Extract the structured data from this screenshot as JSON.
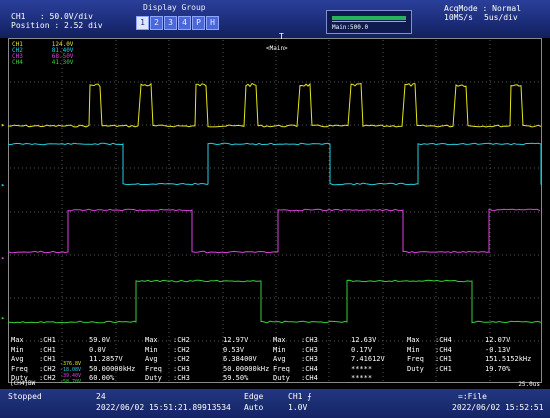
{
  "topbar": {
    "ch1_scale": "CH1   : 50.0V/div",
    "position": "Position : 2.52 div",
    "display_group_title": "Display Group",
    "tabs": [
      "1",
      "2",
      "3",
      "4",
      "P",
      "H"
    ],
    "active_tab": "1",
    "main_zoom": "Main:500.0",
    "acq_mode": "AcqMode : Normal",
    "rate": "10MS/s",
    "timebase": "5us/div"
  },
  "legend": [
    {
      "name": "CH1",
      "value": "124.0V",
      "color": "#e6e61e"
    },
    {
      "name": "CH2",
      "value": "81.40V",
      "color": "#22d0e0"
    },
    {
      "name": "CH3",
      "value": "68.50V",
      "color": "#e040e0"
    },
    {
      "name": "CH4",
      "value": "41.30V",
      "color": "#35d235"
    }
  ],
  "plot": {
    "main_marker": "<Main>",
    "trigger_marker": "T",
    "time_label": "25.0us",
    "ch_box_label": "[CH4]BW"
  },
  "measurements": [
    [
      [
        "Max",
        ":CH1",
        "59.0V"
      ],
      [
        "Max",
        ":CH2",
        "12.97V"
      ],
      [
        "Max",
        ":CH3",
        "12.63V"
      ],
      [
        "Max",
        ":CH4",
        "12.07V"
      ]
    ],
    [
      [
        "Min",
        ":CH1",
        "0.0V"
      ],
      [
        "Min",
        ":CH2",
        "0.53V"
      ],
      [
        "Min",
        ":CH3",
        "0.17V"
      ],
      [
        "Min",
        ":CH4",
        "-0.13V"
      ]
    ],
    [
      [
        "Avg",
        ":CH1",
        "11.2857V"
      ],
      [
        "Avg",
        ":CH2",
        "6.38400V"
      ],
      [
        "Avg",
        ":CH3",
        "7.41612V"
      ],
      [
        "Freq",
        ":CH1",
        "151.5152kHz"
      ]
    ],
    [
      [
        "Freq",
        ":CH2",
        "50.00000kHz"
      ],
      [
        "Freq",
        ":CH3",
        "50.00000kHz"
      ],
      [
        "Freq",
        ":CH4",
        "*****"
      ],
      [
        "Duty",
        ":CH1",
        "19.70%"
      ]
    ],
    [
      [
        "Duty",
        ":CH2",
        "60.00%"
      ],
      [
        "Duty",
        ":CH3",
        "59.50%"
      ],
      [
        "Duty",
        ":CH4",
        "*****"
      ],
      [
        "",
        "",
        ""
      ]
    ]
  ],
  "overlays": [
    "-376.8V",
    "-18.08V",
    "-39.40V",
    "-58.70V"
  ],
  "status": {
    "state": "Stopped",
    "count": "24",
    "timestamp_left": "2022/06/02 15:51:21.89913534",
    "trigger_type": "Edge",
    "trigger_mode": "Auto",
    "trigger_channel": "CH1",
    "trigger_level": "1.0V",
    "file_label": "=:File",
    "timestamp_right": "2022/06/02 15:52:51"
  }
}
